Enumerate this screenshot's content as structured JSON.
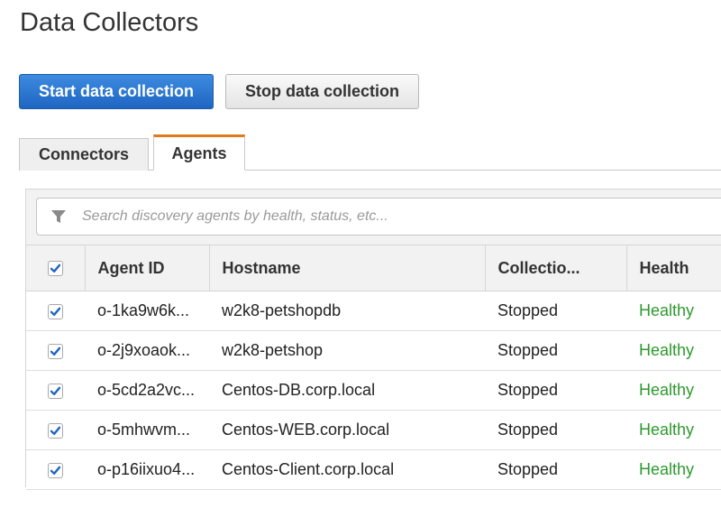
{
  "page": {
    "title": "Data Collectors"
  },
  "actions": {
    "start_label": "Start data collection",
    "stop_label": "Stop data collection"
  },
  "tabs": [
    {
      "label": "Connectors",
      "active": false
    },
    {
      "label": "Agents",
      "active": true
    }
  ],
  "search": {
    "placeholder": "Search discovery agents by health, status, etc...",
    "value": "",
    "icon": "filter-icon"
  },
  "table": {
    "select_all_checked": true,
    "columns": [
      "Agent ID",
      "Hostname",
      "Collectio...",
      "Health"
    ],
    "rows": [
      {
        "checked": true,
        "agent_id": "o-1ka9w6k...",
        "hostname": "w2k8-petshopdb",
        "collection": "Stopped",
        "health": "Healthy"
      },
      {
        "checked": true,
        "agent_id": "o-2j9xoaok...",
        "hostname": "w2k8-petshop",
        "collection": "Stopped",
        "health": "Healthy"
      },
      {
        "checked": true,
        "agent_id": "o-5cd2a2vc...",
        "hostname": "Centos-DB.corp.local",
        "collection": "Stopped",
        "health": "Healthy"
      },
      {
        "checked": true,
        "agent_id": "o-5mhwvm...",
        "hostname": "Centos-WEB.corp.local",
        "collection": "Stopped",
        "health": "Healthy"
      },
      {
        "checked": true,
        "agent_id": "o-p16iixuo4...",
        "hostname": "Centos-Client.corp.local",
        "collection": "Stopped",
        "health": "Healthy"
      }
    ]
  },
  "colors": {
    "primary": "#1f66c2",
    "tab_accent": "#e07b1a",
    "healthy": "#2c9a2c",
    "check": "#1f66c2"
  }
}
